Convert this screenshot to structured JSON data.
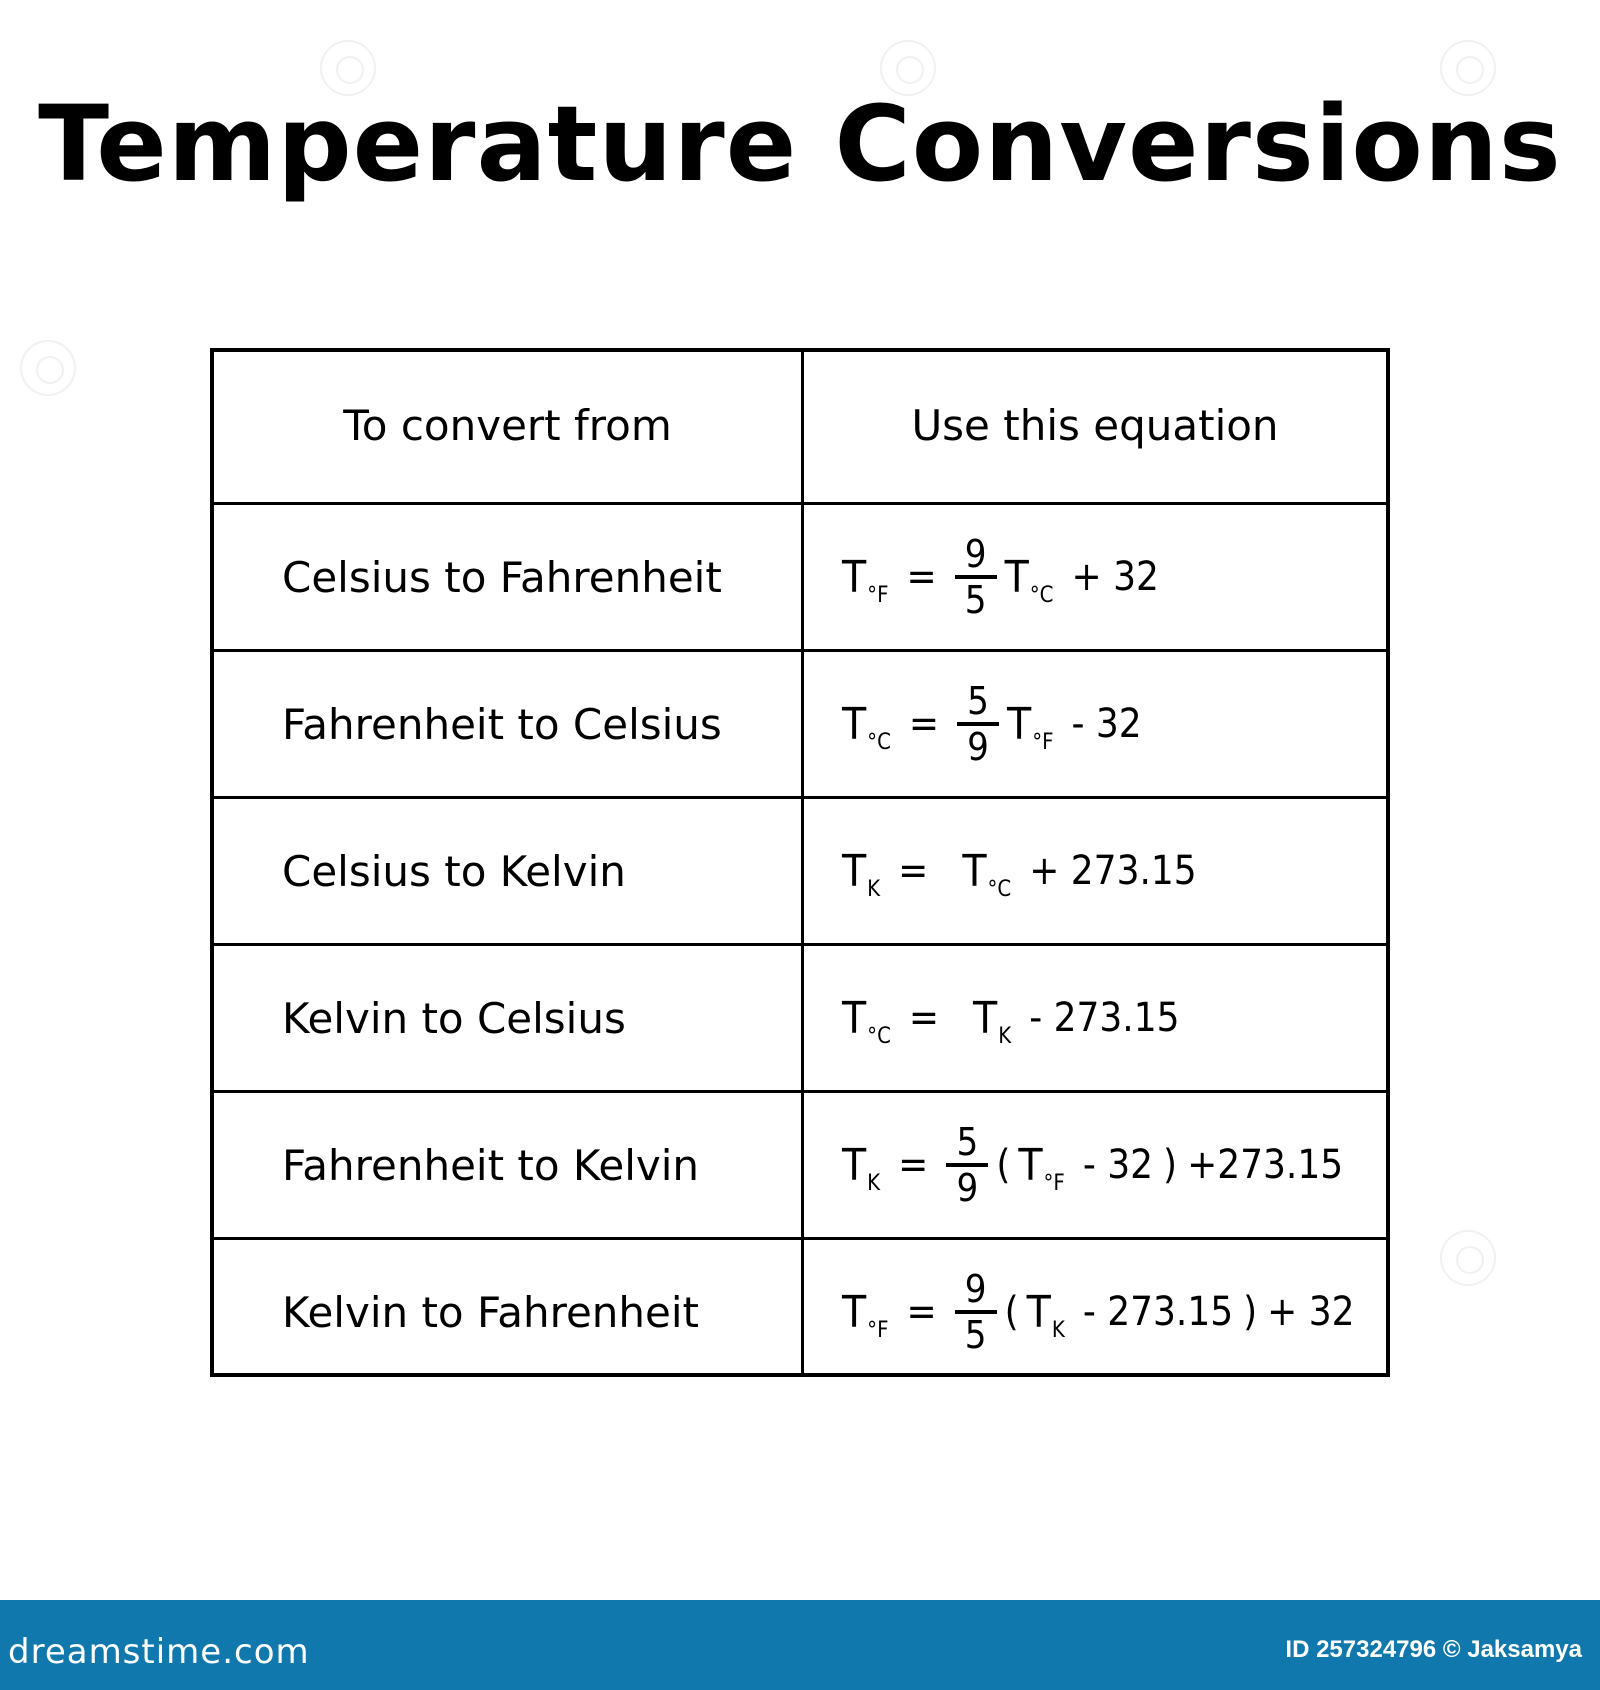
{
  "title": "Temperature Conversions",
  "table": {
    "headers": [
      "To convert from",
      "Use this equation"
    ],
    "rows": [
      {
        "label": "Celsius to Fahrenheit",
        "equation": {
          "lhs": {
            "T": "T",
            "sub": "°F"
          },
          "eq": "=",
          "frac": {
            "num": "9",
            "den": "5"
          },
          "open": "",
          "var": {
            "T": "T",
            "sub": "°C"
          },
          "op": "+ 32",
          "close": "",
          "tail": ""
        }
      },
      {
        "label": "Fahrenheit to Celsius",
        "equation": {
          "lhs": {
            "T": "T",
            "sub": "°C"
          },
          "eq": "=",
          "frac": {
            "num": "5",
            "den": "9"
          },
          "open": "",
          "var": {
            "T": "T",
            "sub": "°F"
          },
          "op": "- 32",
          "close": "",
          "tail": ""
        }
      },
      {
        "label": "Celsius to Kelvin",
        "equation": {
          "lhs": {
            "T": "T",
            "sub": "K"
          },
          "eq": "=",
          "frac": null,
          "open": "",
          "var": {
            "T": "T",
            "sub": "°C"
          },
          "op": "+ 273.15",
          "close": "",
          "tail": ""
        }
      },
      {
        "label": "Kelvin to Celsius",
        "equation": {
          "lhs": {
            "T": "T",
            "sub": "°C"
          },
          "eq": "=",
          "frac": null,
          "open": "",
          "var": {
            "T": "T",
            "sub": "K"
          },
          "op": "- 273.15",
          "close": "",
          "tail": ""
        }
      },
      {
        "label": "Fahrenheit to Kelvin",
        "equation": {
          "lhs": {
            "T": "T",
            "sub": "K"
          },
          "eq": "=",
          "frac": {
            "num": "5",
            "den": "9"
          },
          "open": "(",
          "var": {
            "T": "T",
            "sub": "°F"
          },
          "op": "- 32",
          "close": ")",
          "tail": "+273.15"
        }
      },
      {
        "label": "Kelvin to Fahrenheit",
        "equation": {
          "lhs": {
            "T": "T",
            "sub": "°F"
          },
          "eq": "=",
          "frac": {
            "num": "9",
            "den": "5"
          },
          "open": "(",
          "var": {
            "T": "T",
            "sub": "K"
          },
          "op": "- 273.15",
          "close": ")",
          "tail": "+ 32"
        }
      }
    ]
  },
  "footer": {
    "brand": "dreamstime.com",
    "credit": "ID 257324796 © Jaksamya",
    "background_color": "#1178ad"
  }
}
